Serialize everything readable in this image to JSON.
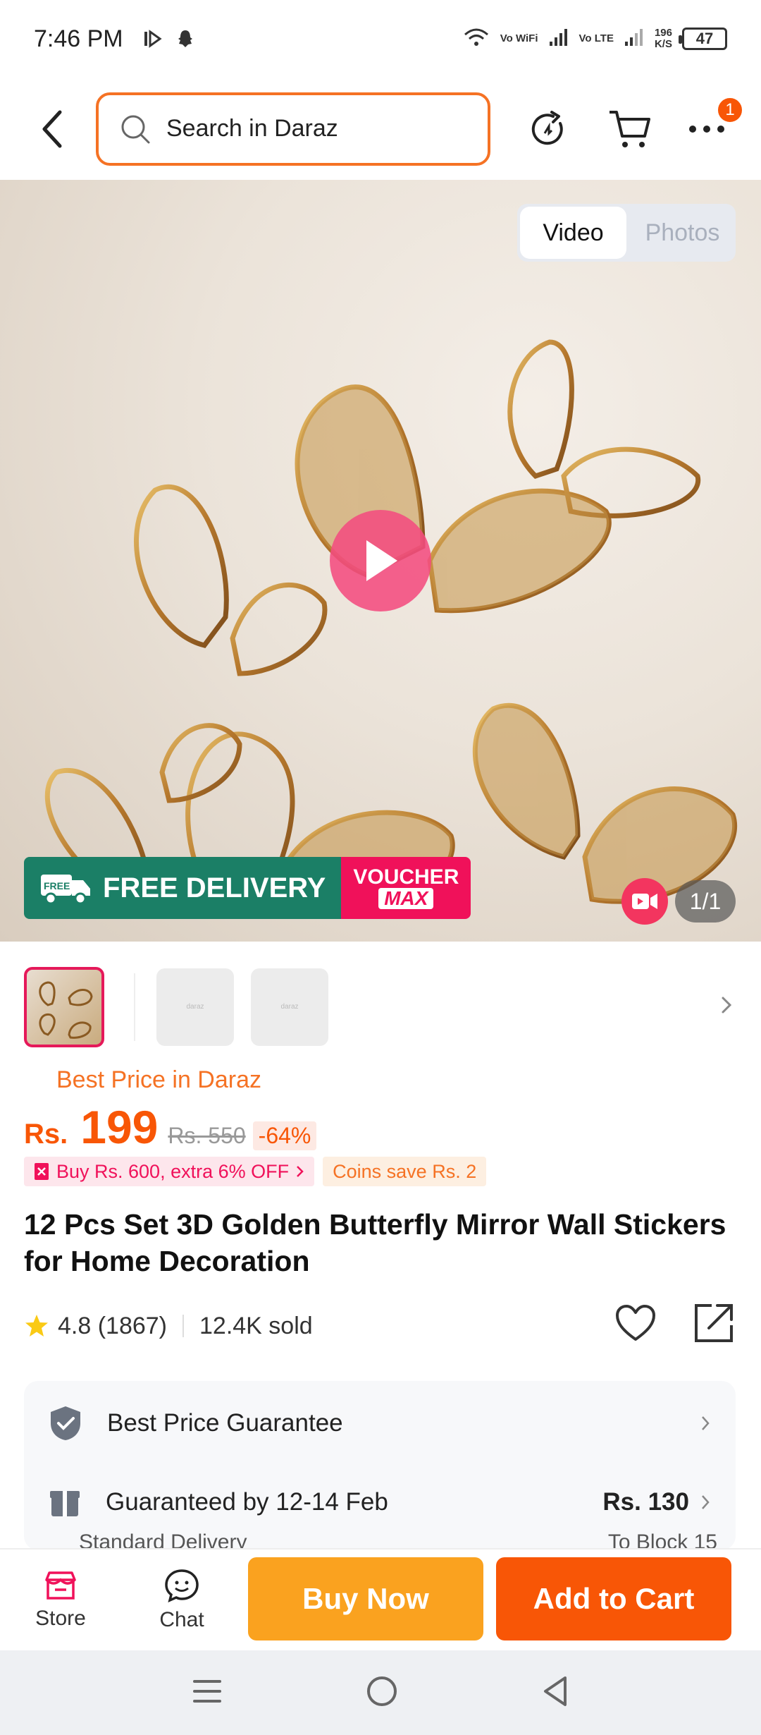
{
  "status_bar": {
    "time": "7:46 PM",
    "wifi_label": "Vo WiFi",
    "lte_label": "Vo LTE",
    "speed_value": "196",
    "speed_unit": "K/S",
    "battery": "47"
  },
  "header": {
    "search_placeholder": "Search in Daraz",
    "cart_badge_count": "1"
  },
  "media": {
    "tabs": [
      {
        "label": "Video",
        "active": true
      },
      {
        "label": "Photos",
        "active": false
      }
    ],
    "promo_free_delivery": "FREE DELIVERY",
    "promo_free_tag": "FREE",
    "promo_voucher_line1": "VOUCHER",
    "promo_voucher_line2": "MAX",
    "counter": "1/1",
    "thumb_placeholder_1": "daraz",
    "thumb_placeholder_2": "daraz"
  },
  "product": {
    "best_price_label": "Best Price in Daraz",
    "currency": "Rs.",
    "price": "199",
    "old_price": "Rs. 550",
    "discount": "-64%",
    "offer": "Buy Rs. 600, extra 6% OFF",
    "coins": "Coins save Rs. 2",
    "title": "12 Pcs Set 3D Golden Butterfly Mirror Wall Stickers for Home Decoration",
    "rating": "4.8 (1867)",
    "sold": "12.4K sold"
  },
  "info": {
    "guarantee_label": "Best Price Guarantee",
    "delivery_label": "Guaranteed by 12-14 Feb",
    "delivery_price": "Rs. 130",
    "delivery_type": "Standard Delivery",
    "delivery_location": "To Block 15"
  },
  "bottom_bar": {
    "store_label": "Store",
    "chat_label": "Chat",
    "buy_now_label": "Buy Now",
    "add_to_cart_label": "Add to Cart"
  },
  "colors": {
    "brand_orange": "#f85606",
    "buy_now": "#faa21f",
    "accent_pink": "#f0115a"
  }
}
